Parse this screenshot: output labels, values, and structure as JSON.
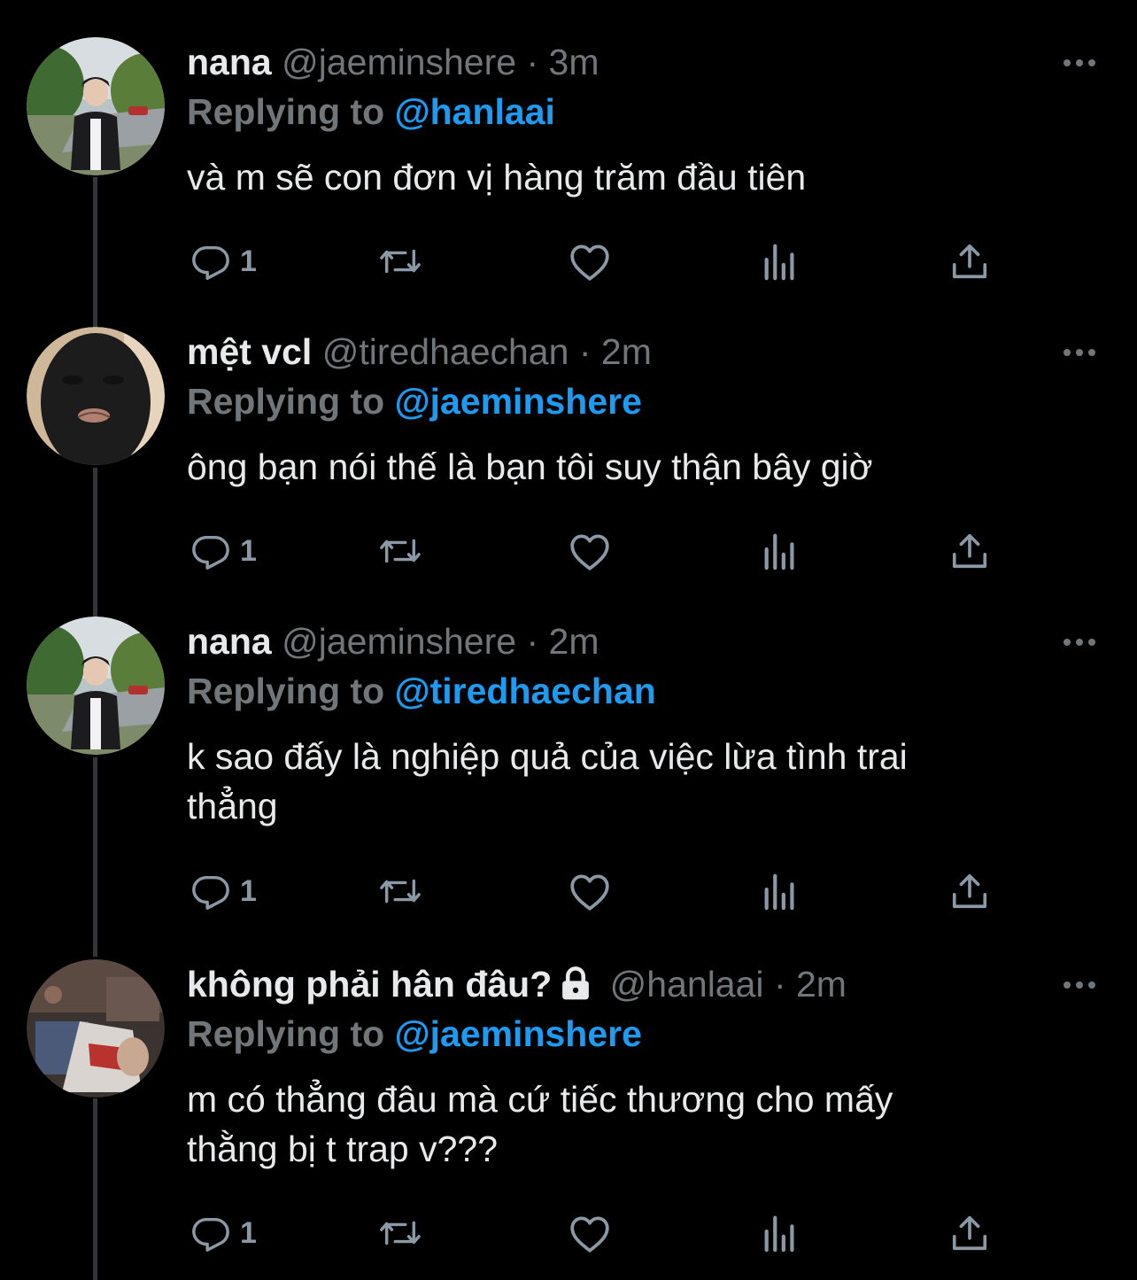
{
  "colors": {
    "background": "#000000",
    "text_primary": "#e7e9ea",
    "text_secondary": "#71767b",
    "link": "#1d9bf0",
    "thread_line": "#333639"
  },
  "action_icons": [
    "reply-icon",
    "retweet-icon",
    "like-icon",
    "analytics-icon",
    "share-icon"
  ],
  "tweets": [
    {
      "display_name": "nana",
      "handle": "@jaeminshere",
      "separator": "·",
      "time": "3m",
      "replying_prefix": "Replying to",
      "replying_to": "@hanlaai",
      "text": "và m sẽ con đơn vị hàng trăm đầu tiên",
      "reply_count": "1",
      "locked": false
    },
    {
      "display_name": "mệt vcl",
      "handle": "@tiredhaechan",
      "separator": "·",
      "time": "2m",
      "replying_prefix": "Replying to",
      "replying_to": "@jaeminshere",
      "text": "ông bạn nói thế là bạn tôi suy thận bây giờ",
      "reply_count": "1",
      "locked": false
    },
    {
      "display_name": "nana",
      "handle": "@jaeminshere",
      "separator": "·",
      "time": "2m",
      "replying_prefix": "Replying to",
      "replying_to": "@tiredhaechan",
      "text": "k sao đấy là nghiệp quả của việc lừa tình trai\nthẳng",
      "reply_count": "1",
      "locked": false
    },
    {
      "display_name": "không phải hân đâu?",
      "handle": "@hanlaai",
      "separator": "·",
      "time": "2m",
      "replying_prefix": "Replying to",
      "replying_to": "@jaeminshere",
      "text": "m có thẳng đâu mà cứ tiếc thương cho mấy\nthằng bị t trap v???",
      "reply_count": "1",
      "locked": true
    }
  ]
}
